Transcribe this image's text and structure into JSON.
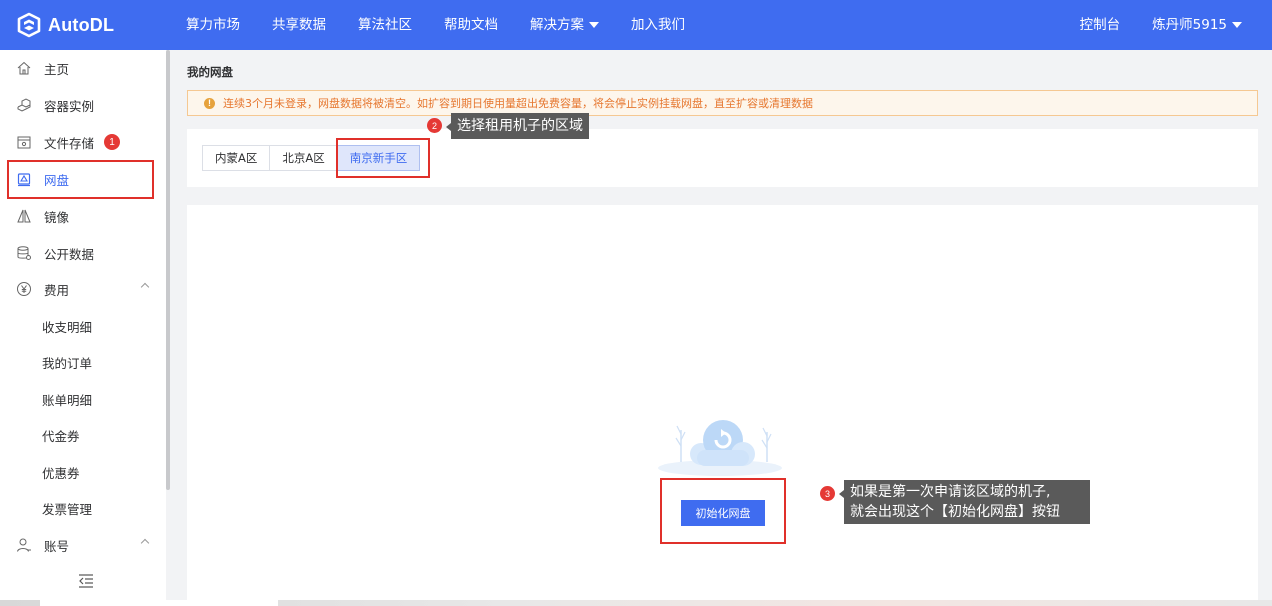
{
  "brand": {
    "name": "AutoDL"
  },
  "nav": {
    "items": [
      "算力市场",
      "共享数据",
      "算法社区",
      "帮助文档",
      "解决方案",
      "加入我们"
    ],
    "console": "控制台",
    "user": "炼丹师5915"
  },
  "sidebar": {
    "items": [
      {
        "label": "主页",
        "icon": "home-icon"
      },
      {
        "label": "容器实例",
        "icon": "container-icon"
      },
      {
        "label": "文件存储",
        "icon": "storage-icon",
        "badge": "1"
      },
      {
        "label": "网盘",
        "icon": "netdisk-icon"
      },
      {
        "label": "镜像",
        "icon": "mirror-icon"
      },
      {
        "label": "公开数据",
        "icon": "database-icon"
      },
      {
        "label": "费用",
        "icon": "yuan-icon"
      },
      {
        "label": "收支明细"
      },
      {
        "label": "我的订单"
      },
      {
        "label": "账单明细"
      },
      {
        "label": "代金券"
      },
      {
        "label": "优惠券"
      },
      {
        "label": "发票管理"
      },
      {
        "label": "账号",
        "icon": "user-icon"
      }
    ]
  },
  "page": {
    "breadcrumb": "我的网盘",
    "alert": "连续3个月未登录，网盘数据将被清空。如扩容到期日使用量超出免费容量，将会停止实例挂载网盘，直至扩容或清理数据",
    "regions": [
      "内蒙A区",
      "北京A区",
      "南京新手区"
    ],
    "selected_region": "南京新手区",
    "init_button": "初始化网盘"
  },
  "annotations": {
    "step2": {
      "num": "2",
      "text": "选择租用机子的区域"
    },
    "step3": {
      "num": "3",
      "line1": "如果是第一次申请该区域的机子,",
      "line2": "就会出现这个【初始化网盘】按钮"
    }
  },
  "colors": {
    "primary": "#3f6cf0",
    "highlight": "#e0302a",
    "warning": "#e6772f"
  }
}
